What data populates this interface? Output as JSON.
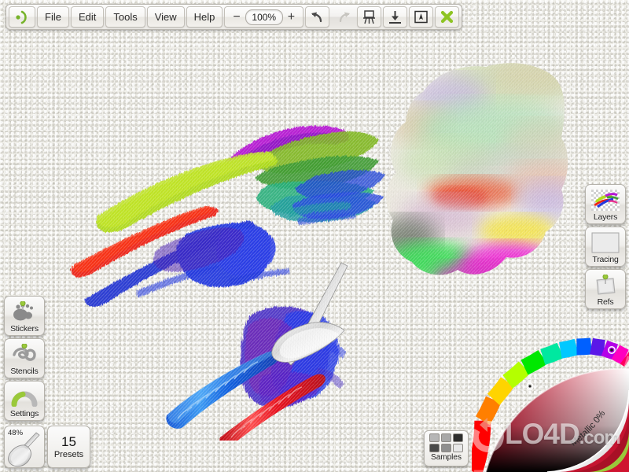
{
  "app": {
    "name": "ArtRage",
    "logo_icon": "artrage-logo-icon"
  },
  "toolbar": {
    "menus": [
      {
        "label": "File",
        "name": "menu-file"
      },
      {
        "label": "Edit",
        "name": "menu-edit"
      },
      {
        "label": "Tools",
        "name": "menu-tools"
      },
      {
        "label": "View",
        "name": "menu-view"
      },
      {
        "label": "Help",
        "name": "menu-help"
      }
    ],
    "zoom": {
      "minus_label": "−",
      "value": "100%",
      "plus_label": "+"
    },
    "actions": [
      {
        "label": "Undo",
        "name": "undo-button",
        "icon": "undo-arrow-icon",
        "enabled": true
      },
      {
        "label": "Redo",
        "name": "redo-button",
        "icon": "redo-arrow-icon",
        "enabled": false
      },
      {
        "label": "Easel",
        "name": "easel-button",
        "icon": "easel-icon",
        "enabled": true
      },
      {
        "label": "Import",
        "name": "import-button",
        "icon": "down-arrow-bar-icon",
        "enabled": true
      },
      {
        "label": "Pen Mode",
        "name": "pen-mode-button",
        "icon": "boxed-pen-icon",
        "enabled": true
      },
      {
        "label": "Close",
        "name": "close-button",
        "icon": "green-x-icon",
        "enabled": true
      }
    ]
  },
  "left_panel": {
    "items": [
      {
        "label": "Stickers",
        "name": "stickers-button",
        "icon": "footprint-pin-icon"
      },
      {
        "label": "Stencils",
        "name": "stencils-button",
        "icon": "stencil-swirl-icon"
      },
      {
        "label": "Settings",
        "name": "settings-button",
        "icon": "gauge-dial-icon"
      }
    ],
    "brush": {
      "name": "brush-preview",
      "size_percent": "48%",
      "icon": "palette-knife-icon"
    },
    "presets": {
      "name": "presets-button",
      "count": "15",
      "label": "Presets"
    }
  },
  "right_panel": {
    "items": [
      {
        "label": "Layers",
        "name": "layers-button",
        "icon": "layers-thumbnail-icon"
      },
      {
        "label": "Tracing",
        "name": "tracing-button",
        "icon": "tracing-blank-icon"
      },
      {
        "label": "Refs",
        "name": "refs-button",
        "icon": "pinned-photo-icon"
      }
    ]
  },
  "samples": {
    "name": "samples-button",
    "label": "Samples",
    "swatches": [
      "#b6b6b6",
      "#a8a8a8",
      "#2e2e2e",
      "#4a4a4a",
      "#8f8f8f",
      "#e8e8e8"
    ]
  },
  "color_picker": {
    "name": "color-picker-wheel",
    "metallic_label": "Metallic 0%",
    "selected_color": "#cf1430",
    "hue_marker_color": "#e8072a",
    "sv_marker": "sv-marker-icon"
  },
  "canvas": {
    "name": "painting-canvas",
    "paper_color": "#f1f0ea",
    "cursor_icon": "palette-knife-cursor"
  },
  "watermark": {
    "text": "LO4D",
    "domain": ".com",
    "logo_icon": "lo4d-circular-arrow-icon"
  }
}
